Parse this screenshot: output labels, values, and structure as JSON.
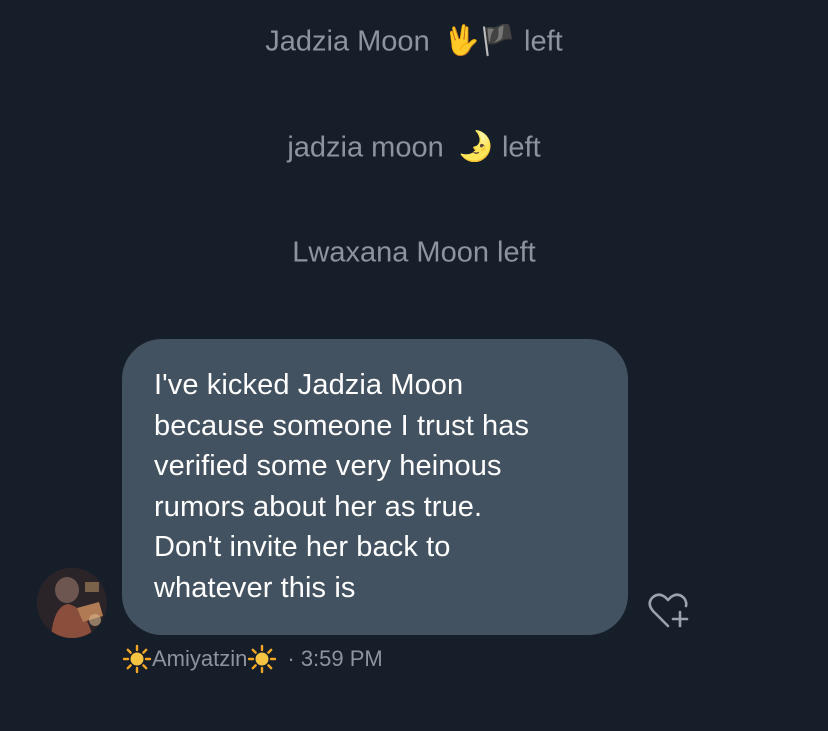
{
  "system_messages": [
    {
      "name": "Jadzia Moon",
      "emoji": "🖖🏴",
      "suffix": "left"
    },
    {
      "name": "jadzia moon",
      "emoji": "🌛",
      "suffix": "left"
    },
    {
      "name": "Lwaxana Moon",
      "emoji": "",
      "suffix": "left"
    }
  ],
  "message": {
    "lines": [
      "I've kicked Jadzia Moon",
      "because someone I trust has",
      "verified some very heinous",
      "rumors about her as true.",
      "Don't invite her back to",
      "whatever this is"
    ],
    "sender_name": "Amiyatzin",
    "sender_decoration_icon": "sun-icon",
    "timestamp_separator": "·",
    "timestamp": "3:59 PM",
    "bubble_color": "#435260"
  },
  "icons": {
    "react": "heart-plus-icon",
    "avatar": "avatar"
  },
  "colors": {
    "background": "#161e29",
    "secondary_text": "#8c949e",
    "bubble_text": "#ffffff"
  }
}
